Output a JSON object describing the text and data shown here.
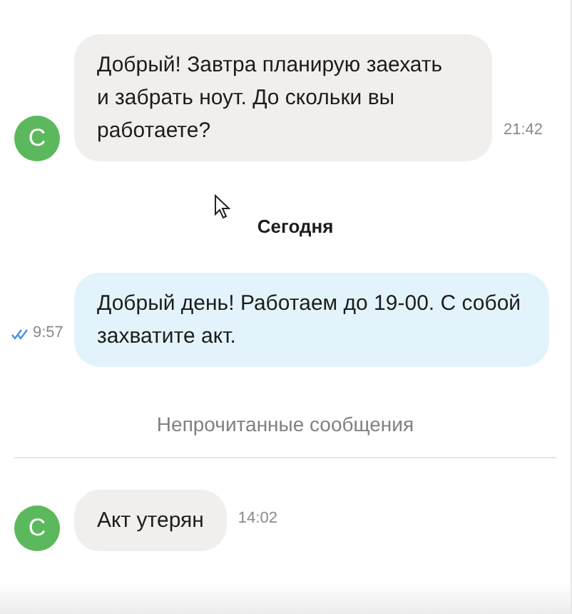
{
  "messages": [
    {
      "kind": "incoming",
      "avatar": "С",
      "text": "Добрый! Завтра планирую заехать и забрать ноут. До скольки вы работаете?",
      "time": "21:42"
    },
    {
      "kind": "date",
      "text": "Сегодня"
    },
    {
      "kind": "outgoing",
      "text": "Добрый день! Работаем до 19-00. С собой захватите акт.",
      "time": "9:57",
      "read": true
    },
    {
      "kind": "unread_divider",
      "text": "Непрочитанные сообщения"
    },
    {
      "kind": "incoming",
      "avatar": "С",
      "text": "Акт утерян",
      "time": "14:02"
    }
  ]
}
